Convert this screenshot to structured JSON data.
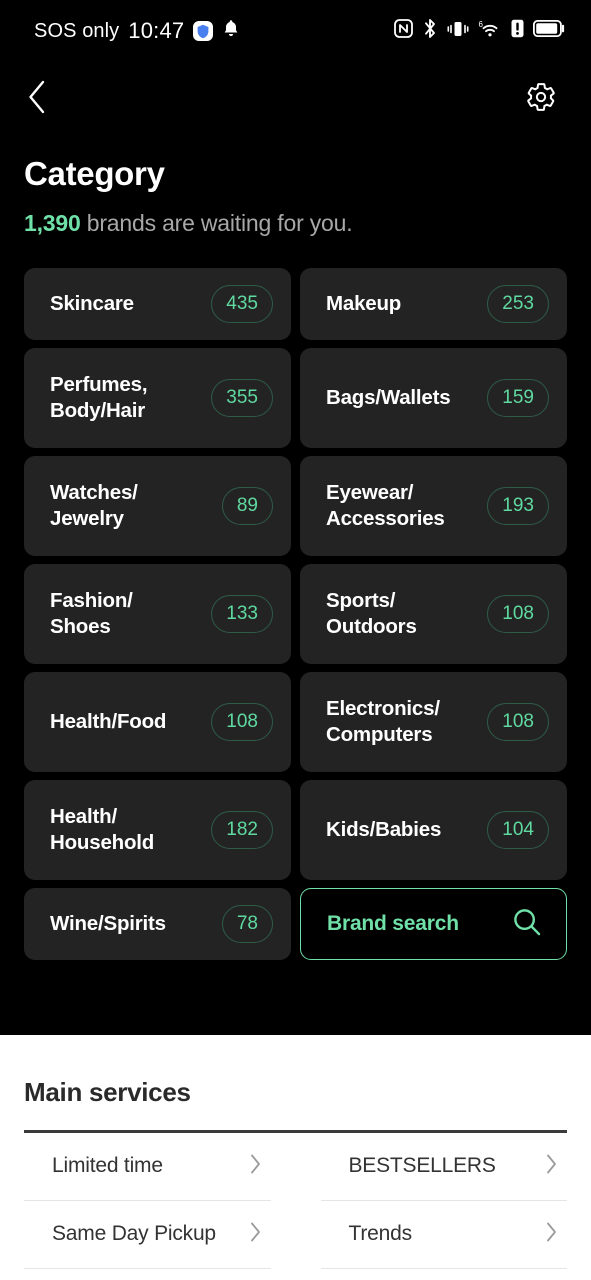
{
  "status_bar": {
    "carrier": "SOS only",
    "time": "10:47",
    "left_icons": [
      "shield-icon",
      "bell-icon"
    ],
    "right_icons": [
      "nfc-icon",
      "bluetooth-icon",
      "vibrate-icon",
      "wifi-6-icon",
      "warning-icon",
      "battery-icon"
    ]
  },
  "nav": {
    "back_icon": "chevron-left-icon",
    "settings_icon": "gear-icon"
  },
  "header": {
    "title": "Category",
    "count": "1,390",
    "subtitle_rest": " brands are waiting for you.",
    "accent_color": "#6fe0a8"
  },
  "categories": [
    {
      "label": "Skincare",
      "count": "435",
      "short": true
    },
    {
      "label": "Makeup",
      "count": "253",
      "short": true
    },
    {
      "label": "Perfumes,\nBody/Hair",
      "count": "355",
      "short": false
    },
    {
      "label": "Bags/Wallets",
      "count": "159",
      "short": false
    },
    {
      "label": "Watches/\nJewelry",
      "count": "89",
      "short": false
    },
    {
      "label": "Eyewear/\nAccessories",
      "count": "193",
      "short": false
    },
    {
      "label": "Fashion/\nShoes",
      "count": "133",
      "short": false
    },
    {
      "label": "Sports/\nOutdoors",
      "count": "108",
      "short": false
    },
    {
      "label": "Health/Food",
      "count": "108",
      "short": false
    },
    {
      "label": "Electronics/\nComputers",
      "count": "108",
      "short": false
    },
    {
      "label": "Health/\nHousehold",
      "count": "182",
      "short": false
    },
    {
      "label": "Kids/Babies",
      "count": "104",
      "short": false
    },
    {
      "label": "Wine/Spirits",
      "count": "78",
      "short": true
    }
  ],
  "brand_search": {
    "label": "Brand search",
    "icon": "search-icon",
    "border_color": "#6fe0a8"
  },
  "main_services": {
    "title": "Main services",
    "items": [
      {
        "label": "Limited time"
      },
      {
        "label": "BESTSELLERS"
      },
      {
        "label": "Same Day Pickup"
      },
      {
        "label": "Trends"
      }
    ]
  }
}
